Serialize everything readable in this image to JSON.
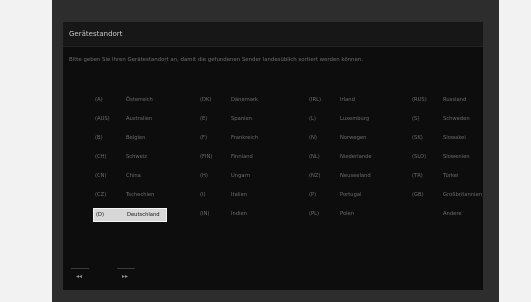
{
  "title": "Gerätestandort",
  "intro": "Bitte geben Sie Ihren Gerätestandort an, damit die gefundenen Sender landesüblich sortiert werden können.",
  "countries": [
    [
      {
        "code": "(A)",
        "name": "Österreich"
      },
      {
        "code": "(AUS)",
        "name": "Australien"
      },
      {
        "code": "(B)",
        "name": "Belgien"
      },
      {
        "code": "(CH)",
        "name": "Schweiz"
      },
      {
        "code": "(CN)",
        "name": "China"
      },
      {
        "code": "(CZ)",
        "name": "Tschechien"
      },
      {
        "code": "(D)",
        "name": "Deutschland",
        "selected": true
      }
    ],
    [
      {
        "code": "(DK)",
        "name": "Dänemark"
      },
      {
        "code": "(E)",
        "name": "Spanien"
      },
      {
        "code": "(F)",
        "name": "Frankreich"
      },
      {
        "code": "(FIN)",
        "name": "Finnland"
      },
      {
        "code": "(H)",
        "name": "Ungarn"
      },
      {
        "code": "(I)",
        "name": "Italien"
      },
      {
        "code": "(IN)",
        "name": "Indien"
      }
    ],
    [
      {
        "code": "(IRL)",
        "name": "Irland"
      },
      {
        "code": "(L)",
        "name": "Luxemburg"
      },
      {
        "code": "(N)",
        "name": "Norwegen"
      },
      {
        "code": "(NL)",
        "name": "Niederlande"
      },
      {
        "code": "(NZ)",
        "name": "Neuseeland"
      },
      {
        "code": "(P)",
        "name": "Portugal"
      },
      {
        "code": "(PL)",
        "name": "Polen"
      }
    ],
    [
      {
        "code": "(RUS)",
        "name": "Russland"
      },
      {
        "code": "(S)",
        "name": "Schweden"
      },
      {
        "code": "(SK)",
        "name": "Slowakei"
      },
      {
        "code": "(SLO)",
        "name": "Slowenien"
      },
      {
        "code": "(TR)",
        "name": "Türkei"
      },
      {
        "code": "(GB)",
        "name": "Großbritannien"
      },
      {
        "code": "",
        "name": "Andere"
      }
    ]
  ],
  "footer": {
    "prev_glyph": "◂◂",
    "next_glyph": "▸▸"
  },
  "colors": {
    "frame": "#2d2d2d",
    "screen": "#0d0d0d",
    "selected_bg": "#d7d7d7"
  }
}
